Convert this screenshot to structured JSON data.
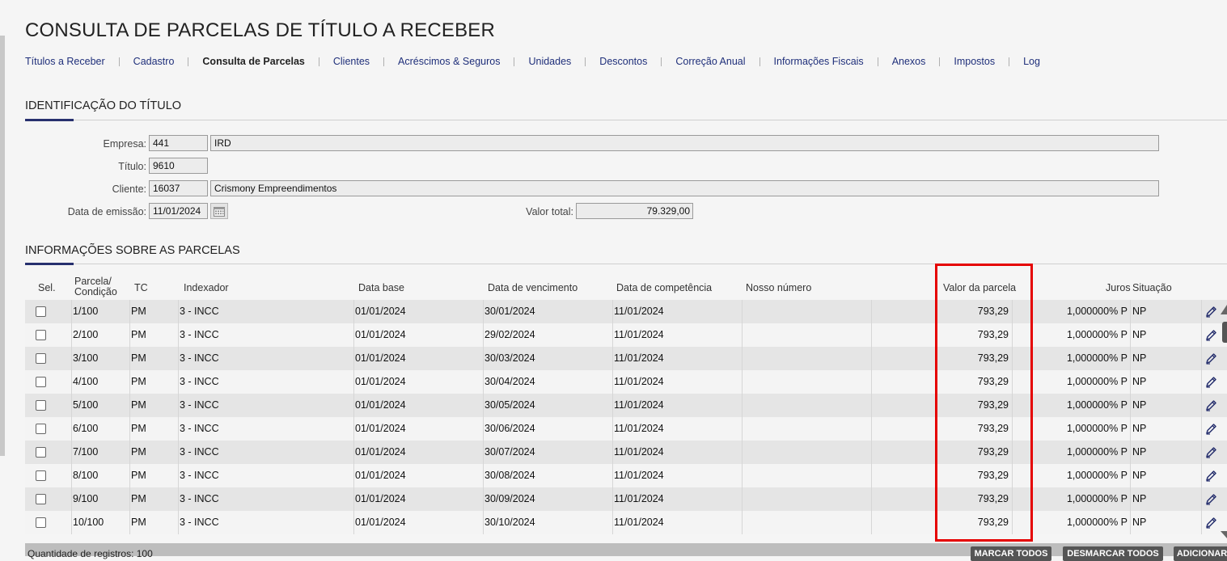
{
  "page_title": "CONSULTA DE PARCELAS DE TÍTULO A RECEBER",
  "tabs": [
    {
      "label": "Títulos a Receber",
      "active": false
    },
    {
      "label": "Cadastro",
      "active": false
    },
    {
      "label": "Consulta de Parcelas",
      "active": true
    },
    {
      "label": "Clientes",
      "active": false
    },
    {
      "label": "Acréscimos & Seguros",
      "active": false
    },
    {
      "label": "Unidades",
      "active": false
    },
    {
      "label": "Descontos",
      "active": false
    },
    {
      "label": "Correção Anual",
      "active": false
    },
    {
      "label": "Informações Fiscais",
      "active": false
    },
    {
      "label": "Anexos",
      "active": false
    },
    {
      "label": "Impostos",
      "active": false
    },
    {
      "label": "Log",
      "active": false
    }
  ],
  "identificacao": {
    "section_title": "IDENTIFICAÇÃO DO TÍTULO",
    "empresa": {
      "label": "Empresa:",
      "code": "441",
      "name": "IRD"
    },
    "titulo": {
      "label": "Título:",
      "value": "9610"
    },
    "cliente": {
      "label": "Cliente:",
      "code": "16037",
      "name": "Crismony Empreendimentos"
    },
    "data_emissao": {
      "label": "Data de emissão:",
      "value": "11/01/2024"
    },
    "valor_total": {
      "label": "Valor total:",
      "value": "79.329,00"
    }
  },
  "parcelas": {
    "section_title": "INFORMAÇÕES SOBRE AS PARCELAS",
    "columns": {
      "sel": "Sel.",
      "parcela_1": "Parcela/",
      "parcela_2": "Condição",
      "tc": "TC",
      "indexador": "Indexador",
      "data_base": "Data base",
      "data_vencimento": "Data de vencimento",
      "data_competencia": "Data de competência",
      "nosso_numero": "Nosso número",
      "valor_parcela": "Valor da parcela",
      "juros": "Juros",
      "situacao": "Situação"
    },
    "rows": [
      {
        "parcela": "1/100",
        "tc": "PM",
        "indexador": "3 - INCC",
        "data_base": "01/01/2024",
        "data_vencimento": "30/01/2024",
        "data_competencia": "11/01/2024",
        "nosso_numero": "",
        "valor": "793,29",
        "juros": "1,000000% P",
        "situacao": "NP"
      },
      {
        "parcela": "2/100",
        "tc": "PM",
        "indexador": "3 - INCC",
        "data_base": "01/01/2024",
        "data_vencimento": "29/02/2024",
        "data_competencia": "11/01/2024",
        "nosso_numero": "",
        "valor": "793,29",
        "juros": "1,000000% P",
        "situacao": "NP"
      },
      {
        "parcela": "3/100",
        "tc": "PM",
        "indexador": "3 - INCC",
        "data_base": "01/01/2024",
        "data_vencimento": "30/03/2024",
        "data_competencia": "11/01/2024",
        "nosso_numero": "",
        "valor": "793,29",
        "juros": "1,000000% P",
        "situacao": "NP"
      },
      {
        "parcela": "4/100",
        "tc": "PM",
        "indexador": "3 - INCC",
        "data_base": "01/01/2024",
        "data_vencimento": "30/04/2024",
        "data_competencia": "11/01/2024",
        "nosso_numero": "",
        "valor": "793,29",
        "juros": "1,000000% P",
        "situacao": "NP"
      },
      {
        "parcela": "5/100",
        "tc": "PM",
        "indexador": "3 - INCC",
        "data_base": "01/01/2024",
        "data_vencimento": "30/05/2024",
        "data_competencia": "11/01/2024",
        "nosso_numero": "",
        "valor": "793,29",
        "juros": "1,000000% P",
        "situacao": "NP"
      },
      {
        "parcela": "6/100",
        "tc": "PM",
        "indexador": "3 - INCC",
        "data_base": "01/01/2024",
        "data_vencimento": "30/06/2024",
        "data_competencia": "11/01/2024",
        "nosso_numero": "",
        "valor": "793,29",
        "juros": "1,000000% P",
        "situacao": "NP"
      },
      {
        "parcela": "7/100",
        "tc": "PM",
        "indexador": "3 - INCC",
        "data_base": "01/01/2024",
        "data_vencimento": "30/07/2024",
        "data_competencia": "11/01/2024",
        "nosso_numero": "",
        "valor": "793,29",
        "juros": "1,000000% P",
        "situacao": "NP"
      },
      {
        "parcela": "8/100",
        "tc": "PM",
        "indexador": "3 - INCC",
        "data_base": "01/01/2024",
        "data_vencimento": "30/08/2024",
        "data_competencia": "11/01/2024",
        "nosso_numero": "",
        "valor": "793,29",
        "juros": "1,000000% P",
        "situacao": "NP"
      },
      {
        "parcela": "9/100",
        "tc": "PM",
        "indexador": "3 - INCC",
        "data_base": "01/01/2024",
        "data_vencimento": "30/09/2024",
        "data_competencia": "11/01/2024",
        "nosso_numero": "",
        "valor": "793,29",
        "juros": "1,000000% P",
        "situacao": "NP"
      },
      {
        "parcela": "10/100",
        "tc": "PM",
        "indexador": "3 - INCC",
        "data_base": "01/01/2024",
        "data_vencimento": "30/10/2024",
        "data_competencia": "11/01/2024",
        "nosso_numero": "",
        "valor": "793,29",
        "juros": "1,000000% P",
        "situacao": "NP"
      }
    ]
  },
  "footer": {
    "registros": "Quantidade de registros: 100",
    "marcar_todos": "MARCAR TODOS",
    "desmarcar_todos": "DESMARCAR TODOS",
    "adicionar": "ADICIONAR"
  },
  "icons": {
    "edit": "pencil-icon",
    "calendar": "calendar-icon"
  },
  "colors": {
    "accent": "#27306e",
    "link": "#1f2f7a",
    "highlight": "#e50000"
  }
}
